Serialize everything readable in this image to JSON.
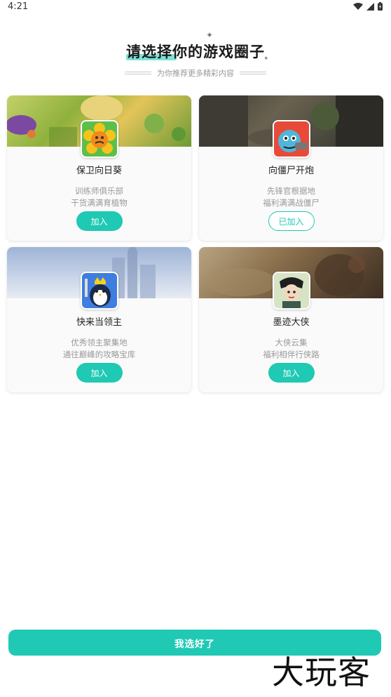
{
  "status_bar": {
    "time": "4:21",
    "icons": [
      "wifi-icon",
      "signal-icon",
      "battery-icon"
    ]
  },
  "header": {
    "title": "请选择你的游戏圈子",
    "highlight_color": "#7fe2d6",
    "subtitle": "为你推荐更多精彩内容"
  },
  "games": [
    {
      "name": "保卫向日葵",
      "desc_line1": "训练师俱乐部",
      "desc_line2": "干货满满育植物",
      "button_label": "加入",
      "joined": false,
      "icon": "sunflower-game-icon"
    },
    {
      "name": "向僵尸开炮",
      "desc_line1": "先锋官根据地",
      "desc_line2": "福利满满战僵尸",
      "button_label": "已加入",
      "joined": true,
      "icon": "zombie-cannon-game-icon"
    },
    {
      "name": "快来当领主",
      "desc_line1": "优秀领主聚集地",
      "desc_line2": "通往巅峰的攻略宝库",
      "button_label": "加入",
      "joined": false,
      "icon": "penguin-lord-game-icon"
    },
    {
      "name": "墨迹大侠",
      "desc_line1": "大侠云集",
      "desc_line2": "福利相伴行侠路",
      "button_label": "加入",
      "joined": false,
      "icon": "ink-hero-game-icon"
    }
  ],
  "confirm_button": {
    "label": "我选好了"
  },
  "watermark": {
    "text": "大玩客"
  },
  "colors": {
    "accent": "#1fc9b4",
    "text_primary": "#222222",
    "text_secondary": "#999999"
  }
}
